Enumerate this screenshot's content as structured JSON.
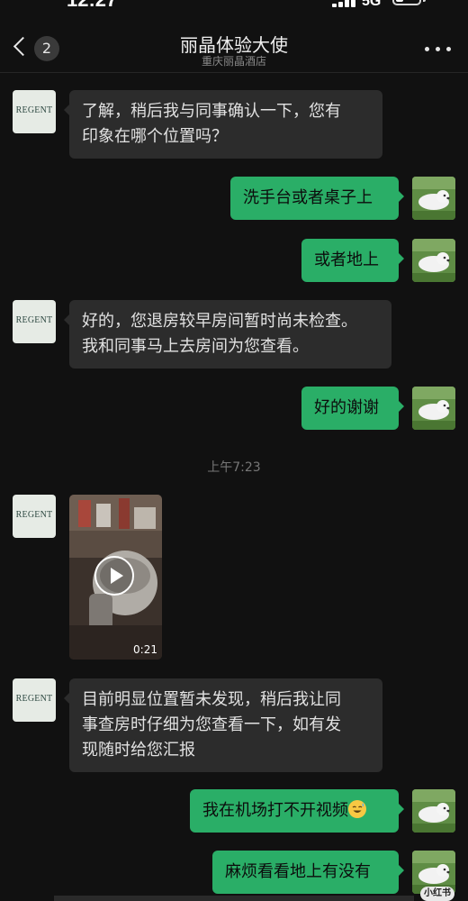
{
  "status_bar": {
    "time": "12:27",
    "network": "5G"
  },
  "header": {
    "back_count": "2",
    "title": "丽晶体验大使",
    "subtitle": "重庆丽晶酒店"
  },
  "contact_logo_text": "REGENT",
  "messages": [
    {
      "side": "in",
      "lines": [
        "了解，稍后我与同事确认一下，您有",
        "印象在哪个位置吗？"
      ]
    },
    {
      "side": "out",
      "text": "洗手台或者桌子上"
    },
    {
      "side": "out",
      "text": "或者地上"
    },
    {
      "side": "in",
      "lines": [
        "好的，您退房较早房间暂时尚未检查。",
        "我和同事马上去房间为您查看。"
      ]
    },
    {
      "side": "out",
      "text": "好的谢谢"
    },
    {
      "side": "in",
      "type": "video",
      "duration": "0:21"
    },
    {
      "side": "in",
      "lines": [
        "目前明显位置暂未发现，稍后我让同",
        "事查房时仔细为您查看一下，如有发",
        "现随时给您汇报"
      ]
    },
    {
      "side": "out",
      "text": "我在机场打不开视频",
      "emoji": "sweat-smile-emoji"
    },
    {
      "side": "out",
      "text": "麻烦看看地上有没有"
    }
  ],
  "timestamp_divider": "上午7:23",
  "watermark": "小红书",
  "colors": {
    "background": "#111111",
    "incoming_bubble": "#2c2c2c",
    "outgoing_bubble": "#2aae67"
  }
}
